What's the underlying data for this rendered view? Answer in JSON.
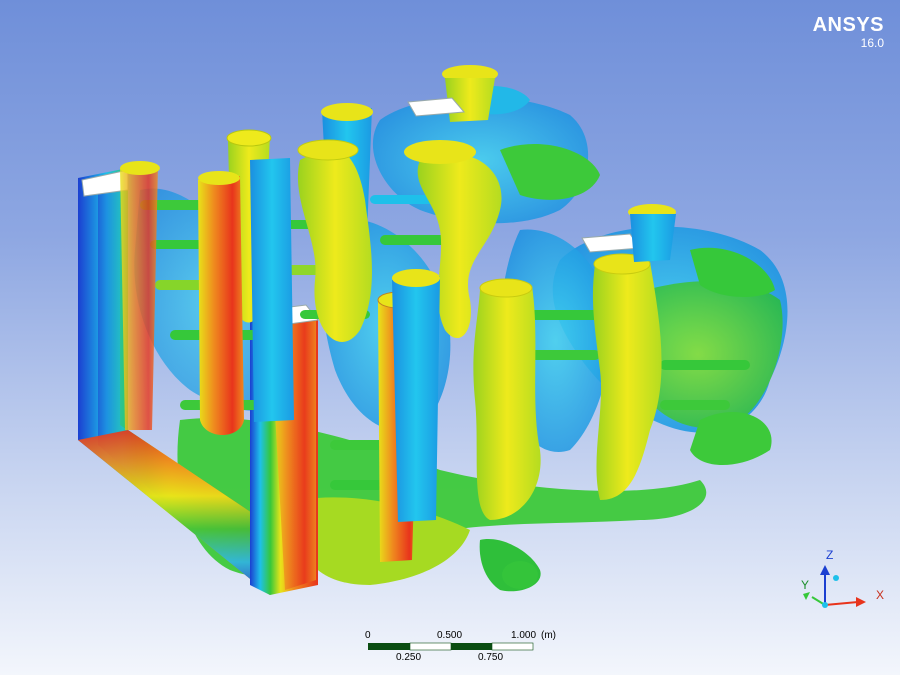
{
  "brand": {
    "name": "ANSYS",
    "version": "16.0"
  },
  "scale_bar": {
    "top_labels": [
      "0",
      "0.500",
      "1.000",
      "(m)"
    ],
    "bottom_labels": [
      "0.250",
      "0.750"
    ]
  },
  "triad": {
    "z": "Z",
    "y": "Y",
    "x": "X"
  },
  "colors": {
    "background_top": "#6f8fd9",
    "background_bottom": "#f3f6fc",
    "scale_dark": "#0b4d12",
    "red": "#e8341c",
    "orange": "#ef8a1e",
    "yellow": "#e8e419",
    "green": "#36c83a",
    "cyan": "#1ec0ea",
    "blue": "#1b3fd1"
  }
}
